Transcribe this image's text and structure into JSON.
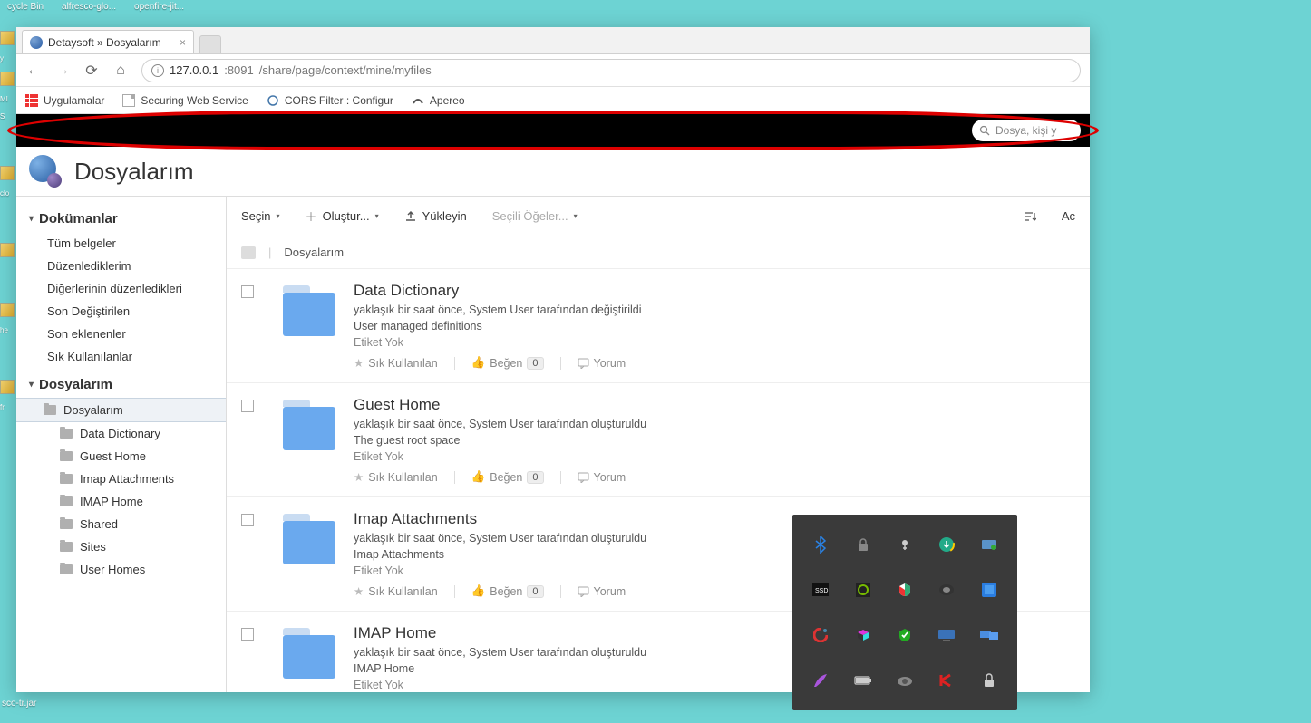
{
  "desktop": {
    "icons": [
      "cycle Bin",
      "alfresco-glo...",
      "openfire-jit..."
    ],
    "taskbar_file": "sco-tr.jar"
  },
  "left_edge": [
    "y",
    "MI",
    "S",
    "",
    "clo",
    "",
    "he",
    "",
    "fr",
    ""
  ],
  "browser": {
    "tab_title": "Detaysoft » Dosyalarım",
    "url_host": "127.0.0.1",
    "url_port": ":8091",
    "url_path": "/share/page/context/mine/myfiles",
    "bookmarks": {
      "apps": "Uygulamalar",
      "items": [
        "Securing Web Service",
        "CORS Filter : Configur",
        "Apereo"
      ]
    }
  },
  "header": {
    "search_placeholder": "Dosya, kişi y",
    "page_title": "Dosyalarım"
  },
  "sidebar": {
    "section1": {
      "title": "Dokümanlar",
      "links": [
        "Tüm belgeler",
        "Düzenlediklerim",
        "Diğerlerinin düzenledikleri",
        "Son Değiştirilen",
        "Son eklenenler",
        "Sık Kullanılanlar"
      ]
    },
    "section2": {
      "title": "Dosyalarım",
      "root": "Dosyalarım",
      "children": [
        "Data Dictionary",
        "Guest Home",
        "Imap Attachments",
        "IMAP Home",
        "Shared",
        "Sites",
        "User Homes"
      ]
    }
  },
  "toolbar": {
    "select": "Seçin",
    "create": "Oluştur...",
    "upload": "Yükleyin",
    "selected": "Seçili Öğeler...",
    "right": "Ac"
  },
  "breadcrumb": {
    "current": "Dosyalarım"
  },
  "actions": {
    "fav": "Sık Kullanılan",
    "like": "Beğen",
    "like_count": "0",
    "comment": "Yorum",
    "no_tags": "Etiket Yok"
  },
  "files": [
    {
      "name": "Data Dictionary",
      "sub": "yaklaşık bir saat önce, System User tarafından değiştirildi",
      "desc": "User managed definitions"
    },
    {
      "name": "Guest Home",
      "sub": "yaklaşık bir saat önce, System User tarafından oluşturuldu",
      "desc": "The guest root space"
    },
    {
      "name": "Imap Attachments",
      "sub": "yaklaşık bir saat önce, System User tarafından oluşturuldu",
      "desc": "Imap Attachments"
    },
    {
      "name": "IMAP Home",
      "sub": "yaklaşık bir saat önce, System User tarafından oluşturuldu",
      "desc": "IMAP Home"
    }
  ]
}
